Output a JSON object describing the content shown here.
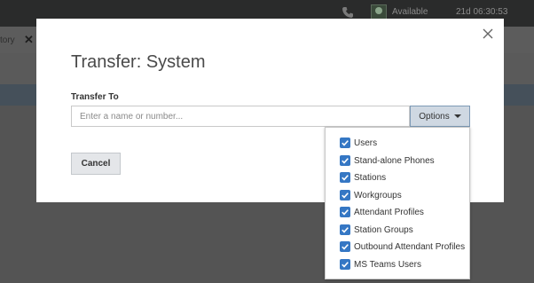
{
  "header": {
    "status": "Available",
    "timer": "21d 06:30:53",
    "icons": [
      "phone-icon",
      "avatar"
    ]
  },
  "background_tab": {
    "label": "tory",
    "close_icon": "close-icon"
  },
  "dialog": {
    "title": "Transfer: System",
    "transfer_to_label": "Transfer To",
    "input_value": "",
    "input_placeholder": "Enter a name or number...",
    "options_label": "Options",
    "cancel_label": "Cancel"
  },
  "options_menu": {
    "items": [
      {
        "label": "Users",
        "checked": true
      },
      {
        "label": "Stand-alone Phones",
        "checked": true
      },
      {
        "label": "Stations",
        "checked": true
      },
      {
        "label": "Workgroups",
        "checked": true
      },
      {
        "label": "Attendant Profiles",
        "checked": true
      },
      {
        "label": "Station Groups",
        "checked": true
      },
      {
        "label": "Outbound Attendant Profiles",
        "checked": true
      },
      {
        "label": "MS Teams Users",
        "checked": true
      }
    ]
  },
  "colors": {
    "overlay": "#545454",
    "accent_check": "#3577c4",
    "options_button_bg": "#cfd8e2",
    "options_button_border": "#7e9ab6"
  }
}
